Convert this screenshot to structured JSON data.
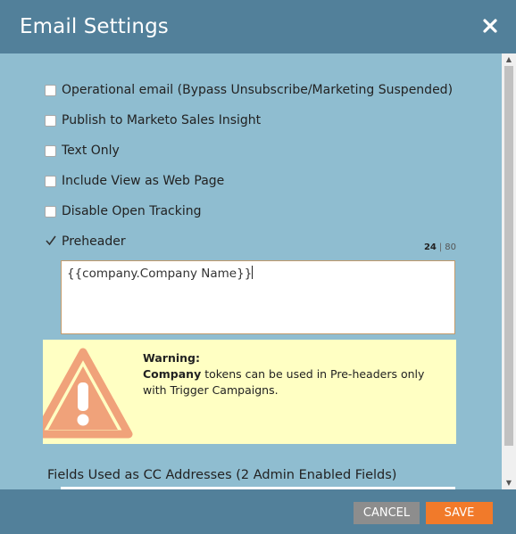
{
  "dialog": {
    "title": "Email Settings",
    "close_icon": "close-icon"
  },
  "options": [
    {
      "label": "Operational email (Bypass Unsubscribe/Marketing Suspended)",
      "checked": false
    },
    {
      "label": "Publish to Marketo Sales Insight",
      "checked": false
    },
    {
      "label": "Text Only",
      "checked": false
    },
    {
      "label": "Include View as Web Page",
      "checked": false
    },
    {
      "label": "Disable Open Tracking",
      "checked": false
    },
    {
      "label": "Preheader",
      "checked": true
    }
  ],
  "preheader": {
    "value": "{{company.Company Name}}",
    "char_count": "24",
    "char_max": "80",
    "separator": "|"
  },
  "warning": {
    "icon": "warning-triangle-icon",
    "title": "Warning:",
    "strong": "Company",
    "message": " tokens can be used in Pre-headers only with Trigger Campaigns."
  },
  "cc": {
    "label": "Fields Used as CC Addresses (2 Admin Enabled Fields)"
  },
  "footer": {
    "cancel_label": "CANCEL",
    "save_label": "SAVE"
  },
  "colors": {
    "header": "#52809a",
    "body": "#8fbdd0",
    "warning_bg": "#ffffc3",
    "warning_icon": "#f0a27a",
    "save": "#f17a2a",
    "cancel": "#8d8d8d"
  }
}
